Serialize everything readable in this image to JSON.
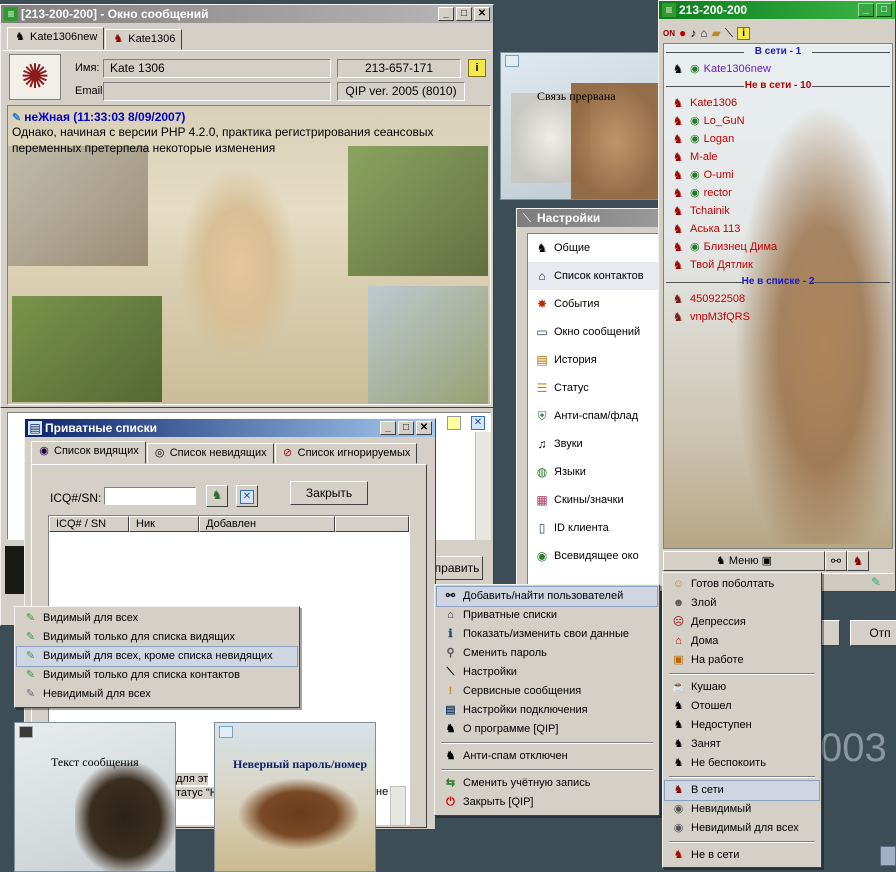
{
  "background": {
    "large_text": "003"
  },
  "msg_window": {
    "title": "[213-200-200] - Окно сообщений",
    "tabs": [
      "Kate1306new",
      "Kate1306"
    ],
    "name_label": "Имя:",
    "name_value": "Kate  1306",
    "uin_value": "213-657-171",
    "email_label": "Email:",
    "email_value": "",
    "client_value": "QIP ver. 2005 (8010)",
    "message_header": "неЖная (11:33:03 8/09/2007)",
    "message_text": "Однако, начиная с версии PHP 4.2.0, практика регистрирования сеансовых переменных претерпела некоторые изменения",
    "send_button": "править"
  },
  "popup_connection": {
    "text": "Связь прервана"
  },
  "popup_message": {
    "text": "Текст сообщения"
  },
  "popup_badpass": {
    "text": "Неверный пароль/номер"
  },
  "partial_text": {
    "line1": "для эт",
    "line2": "татус \"Н",
    "ne": "не"
  },
  "contact_list": {
    "title": "213-200-200",
    "group_online": "В сети - 1",
    "online": [
      {
        "name": "Kate1306new",
        "eye": true,
        "color": "#6a1fbf"
      }
    ],
    "group_offline": "Не в сети - 10",
    "offline": [
      {
        "name": "Kate1306",
        "eye": false
      },
      {
        "name": "Lo_GuN",
        "eye": true
      },
      {
        "name": "Logan",
        "eye": true
      },
      {
        "name": "M-ale",
        "eye": false
      },
      {
        "name": "O-umi",
        "eye": true
      },
      {
        "name": "rector",
        "eye": true
      },
      {
        "name": "Tchainik",
        "eye": false
      },
      {
        "name": "Аська 113",
        "eye": false
      },
      {
        "name": "Близнец Дима",
        "eye": true
      },
      {
        "name": "Твой Дятлик",
        "eye": false
      }
    ],
    "group_notlist": "Не в списке - 2",
    "notlist": [
      {
        "name": "450922508"
      },
      {
        "name": "vnpM3fQRS"
      }
    ],
    "menu_button": "Меню"
  },
  "settings": {
    "title": "Настройки",
    "items": [
      {
        "label": "Общие",
        "icon": "horse-icon"
      },
      {
        "label": "Список контактов",
        "icon": "house-icon"
      },
      {
        "label": "События",
        "icon": "star-icon"
      },
      {
        "label": "Окно сообщений",
        "icon": "window-icon"
      },
      {
        "label": "История",
        "icon": "history-icon"
      },
      {
        "label": "Статус",
        "icon": "status-icon"
      },
      {
        "label": "Анти-спам/флад",
        "icon": "shield-icon"
      },
      {
        "label": "Звуки",
        "icon": "note-icon"
      },
      {
        "label": "Языки",
        "icon": "globe-icon"
      },
      {
        "label": "Скины/значки",
        "icon": "shirt-icon"
      },
      {
        "label": "ID клиента",
        "icon": "id-icon"
      },
      {
        "label": "Всевидящее око",
        "icon": "eye-icon"
      }
    ]
  },
  "private_lists": {
    "title": "Приватные списки",
    "tabs": [
      "Список видящих",
      "Список невидящих",
      "Список игнорируемых"
    ],
    "icq_label": "ICQ#/SN:",
    "icq_value": "",
    "close_button": "Закрыть",
    "columns": [
      "ICQ# / SN",
      "Ник",
      "Добавлен"
    ]
  },
  "visibility_menu": {
    "items": [
      "Видимый для всех",
      "Видимый только для списка видящих",
      "Видимый для всех, кроме списка невидящих",
      "Видимый только для списка контактов",
      "Невидимый для всех"
    ]
  },
  "main_menu": {
    "items": [
      "Добавить/найти пользователей",
      "Приватные списки",
      "Показать/изменить свои данные",
      "Сменить пароль",
      "Настройки",
      "Сервисные сообщения",
      "Настройки подключения",
      "О программе [QIP]",
      "Анти-спам отключен",
      "Сменить учётную запись",
      "Закрыть [QIP]"
    ]
  },
  "status_menu": {
    "items": [
      "Готов поболтать",
      "Злой",
      "Депрессия",
      "Дома",
      "На работе",
      "Кушаю",
      "Отошел",
      "Недоступен",
      "Занят",
      "Не беспокоить",
      "В сети",
      "Невидимый",
      "Невидимый для всех",
      "Не в сети"
    ]
  },
  "right_button": {
    "label": "Отп"
  }
}
